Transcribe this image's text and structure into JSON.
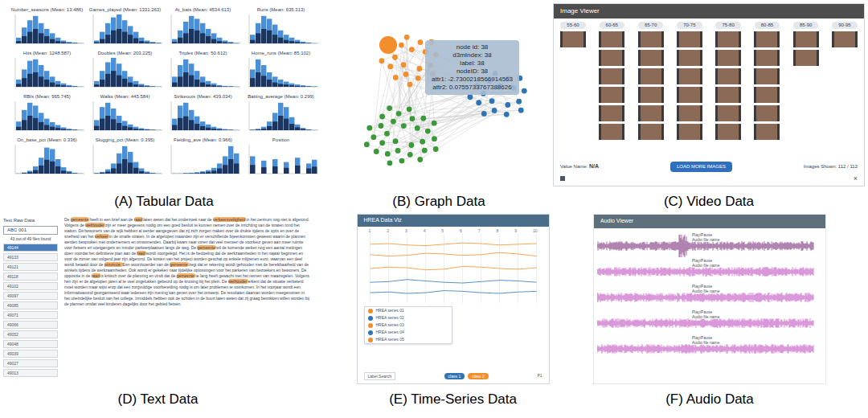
{
  "figure": {
    "panels": [
      {
        "id": "tabular",
        "caption": "(A) Tabular Data"
      },
      {
        "id": "graph",
        "caption": "(B) Graph Data"
      },
      {
        "id": "video",
        "caption": "(C) Video Data"
      },
      {
        "id": "text",
        "caption": "(D) Text Data"
      },
      {
        "id": "timeseries",
        "caption": "(E) Time-Series Data"
      },
      {
        "id": "audio",
        "caption": "(F) Audio Data"
      }
    ]
  },
  "tabular": {
    "charts": [
      {
        "title": "Number_seasons (Mean: 13.486)",
        "all": [
          20,
          55,
          80,
          95,
          70,
          50,
          35,
          20,
          10,
          5,
          3,
          1
        ],
        "selected": [
          8,
          25,
          40,
          50,
          35,
          25,
          15,
          8,
          4,
          2,
          1,
          0
        ]
      },
      {
        "title": "Games_played (Mean: 1331.263)",
        "all": [
          10,
          40,
          70,
          90,
          100,
          80,
          60,
          40,
          20,
          10,
          5,
          2
        ],
        "selected": [
          4,
          15,
          30,
          45,
          50,
          40,
          30,
          18,
          8,
          4,
          2,
          1
        ]
      },
      {
        "title": "At_bats (Mean: 4534.613)",
        "all": [
          15,
          45,
          75,
          95,
          85,
          70,
          50,
          35,
          20,
          10,
          5,
          2
        ],
        "selected": [
          5,
          20,
          35,
          50,
          45,
          35,
          25,
          15,
          8,
          4,
          2,
          0
        ]
      },
      {
        "title": "Runs (Mean: 635.313)",
        "all": [
          30,
          70,
          95,
          85,
          65,
          45,
          30,
          20,
          12,
          6,
          3,
          1
        ],
        "selected": [
          12,
          35,
          50,
          45,
          30,
          20,
          12,
          8,
          5,
          2,
          1,
          0
        ]
      },
      {
        "title": "Hits (Mean: 1248.587)",
        "all": [
          25,
          60,
          90,
          95,
          75,
          55,
          35,
          20,
          12,
          6,
          3,
          1
        ],
        "selected": [
          10,
          30,
          45,
          50,
          35,
          25,
          15,
          8,
          5,
          2,
          1,
          0
        ]
      },
      {
        "title": "Doubles (Mean: 203.225)",
        "all": [
          20,
          55,
          85,
          100,
          80,
          55,
          35,
          20,
          10,
          5,
          2,
          1
        ],
        "selected": [
          8,
          25,
          45,
          55,
          40,
          28,
          15,
          8,
          4,
          2,
          1,
          0
        ]
      },
      {
        "title": "Triples (Mean: 50.612)",
        "all": [
          35,
          75,
          95,
          80,
          55,
          35,
          20,
          12,
          6,
          3,
          2,
          1
        ],
        "selected": [
          15,
          35,
          50,
          40,
          25,
          15,
          8,
          5,
          2,
          1,
          1,
          0
        ]
      },
      {
        "title": "Home_runs (Mean: 85.102)",
        "all": [
          60,
          95,
          75,
          50,
          35,
          25,
          18,
          12,
          8,
          5,
          3,
          2
        ],
        "selected": [
          30,
          50,
          38,
          25,
          15,
          10,
          8,
          5,
          3,
          2,
          1,
          0
        ]
      },
      {
        "title": "RBIs (Mean: 565.745)",
        "all": [
          30,
          70,
          95,
          85,
          60,
          40,
          28,
          18,
          10,
          5,
          3,
          1
        ],
        "selected": [
          12,
          35,
          50,
          42,
          28,
          18,
          12,
          8,
          4,
          2,
          1,
          0
        ]
      },
      {
        "title": "Walks (Mean: 445.584)",
        "all": [
          35,
          80,
          95,
          75,
          50,
          32,
          20,
          12,
          7,
          4,
          2,
          1
        ],
        "selected": [
          15,
          40,
          50,
          38,
          25,
          15,
          10,
          5,
          3,
          2,
          1,
          0
        ]
      },
      {
        "title": "Strikeouts (Mean: 439.034)",
        "all": [
          40,
          85,
          95,
          70,
          48,
          30,
          20,
          12,
          7,
          4,
          2,
          1
        ],
        "selected": [
          18,
          42,
          48,
          35,
          22,
          14,
          9,
          5,
          3,
          1,
          1,
          0
        ]
      },
      {
        "title": "Batting_average (Mean: 0.299)",
        "all": [
          2,
          5,
          12,
          30,
          60,
          95,
          80,
          45,
          20,
          8,
          3,
          1
        ],
        "selected": [
          1,
          2,
          5,
          14,
          30,
          50,
          40,
          22,
          10,
          4,
          1,
          0
        ]
      },
      {
        "title": "On_base_pct (Mean: 0.336)",
        "all": [
          1,
          4,
          10,
          25,
          55,
          90,
          85,
          50,
          22,
          9,
          3,
          1
        ],
        "selected": [
          0,
          2,
          5,
          12,
          28,
          48,
          42,
          25,
          10,
          4,
          1,
          0
        ]
      },
      {
        "title": "Slugging_pct (Mean: 0.395)",
        "all": [
          2,
          6,
          15,
          35,
          70,
          95,
          75,
          40,
          18,
          7,
          3,
          1
        ],
        "selected": [
          1,
          3,
          7,
          18,
          35,
          50,
          38,
          20,
          8,
          3,
          1,
          0
        ]
      },
      {
        "title": "Fielding_ave (Mean: 0.966)",
        "all": [
          1,
          1,
          2,
          3,
          5,
          8,
          12,
          20,
          35,
          60,
          95,
          70
        ],
        "selected": [
          0,
          0,
          1,
          1,
          2,
          4,
          6,
          10,
          18,
          30,
          50,
          35
        ]
      },
      {
        "title": "Position",
        "all": [
          60,
          0,
          45,
          0,
          50,
          0,
          40,
          0,
          55,
          0,
          35,
          48
        ],
        "selected": [
          30,
          0,
          22,
          0,
          25,
          0,
          20,
          0,
          28,
          0,
          18,
          24
        ]
      }
    ]
  },
  "graph": {
    "nodes": [
      {
        "kind": "hub",
        "color": "#f28e2b"
      },
      {
        "kind": "node",
        "color": "#f28e2b"
      },
      {
        "kind": "node",
        "color": "#f28e2b"
      },
      {
        "kind": "node",
        "color": "#f28e2b"
      },
      {
        "kind": "node",
        "color": "#f28e2b"
      },
      {
        "kind": "node",
        "color": "#f28e2b"
      },
      {
        "kind": "node",
        "color": "#f28e2b"
      },
      {
        "kind": "node",
        "color": "#f28e2b"
      },
      {
        "kind": "node",
        "color": "#f28e2b"
      },
      {
        "kind": "node",
        "color": "#f28e2b"
      },
      {
        "kind": "node",
        "color": "#f28e2b"
      },
      {
        "kind": "node",
        "color": "#f28e2b"
      },
      {
        "kind": "node",
        "color": "#f28e2b"
      },
      {
        "kind": "node",
        "color": "#f28e2b"
      },
      {
        "kind": "node",
        "color": "#f28e2b"
      },
      {
        "kind": "node",
        "color": "#f28e2b"
      },
      {
        "kind": "node",
        "color": "#f28e2b"
      },
      {
        "kind": "node",
        "color": "#f28e2b"
      },
      {
        "kind": "node",
        "color": "#f28e2b"
      },
      {
        "kind": "node",
        "color": "#f28e2b"
      },
      {
        "kind": "node",
        "color": "#2e75b6"
      },
      {
        "kind": "node",
        "color": "#2e75b6"
      },
      {
        "kind": "node",
        "color": "#2e75b6"
      },
      {
        "kind": "node",
        "color": "#2e75b6"
      },
      {
        "kind": "node",
        "color": "#2e75b6"
      },
      {
        "kind": "node",
        "color": "#2e75b6"
      },
      {
        "kind": "node",
        "color": "#2e75b6"
      },
      {
        "kind": "node",
        "color": "#2e75b6"
      },
      {
        "kind": "node",
        "color": "#2e75b6"
      },
      {
        "kind": "node",
        "color": "#2e75b6"
      },
      {
        "kind": "node",
        "color": "#2e75b6"
      },
      {
        "kind": "node",
        "color": "#2e75b6"
      },
      {
        "kind": "node",
        "color": "#2e75b6"
      },
      {
        "kind": "node",
        "color": "#2e75b6"
      },
      {
        "kind": "node",
        "color": "#2e75b6"
      },
      {
        "kind": "node",
        "color": "#2e75b6"
      },
      {
        "kind": "node",
        "color": "#2e75b6"
      },
      {
        "kind": "node",
        "color": "#2e75b6"
      },
      {
        "kind": "node",
        "color": "#3a9a3a"
      },
      {
        "kind": "node",
        "color": "#3a9a3a"
      },
      {
        "kind": "node",
        "color": "#3a9a3a"
      },
      {
        "kind": "node",
        "color": "#3a9a3a"
      },
      {
        "kind": "node",
        "color": "#3a9a3a"
      },
      {
        "kind": "node",
        "color": "#3a9a3a"
      },
      {
        "kind": "node",
        "color": "#3a9a3a"
      },
      {
        "kind": "node",
        "color": "#3a9a3a"
      },
      {
        "kind": "node",
        "color": "#3a9a3a"
      },
      {
        "kind": "node",
        "color": "#3a9a3a"
      },
      {
        "kind": "node",
        "color": "#3a9a3a"
      },
      {
        "kind": "node",
        "color": "#3a9a3a"
      },
      {
        "kind": "node",
        "color": "#3a9a3a"
      },
      {
        "kind": "node",
        "color": "#3a9a3a"
      },
      {
        "kind": "node",
        "color": "#3a9a3a"
      },
      {
        "kind": "node",
        "color": "#3a9a3a"
      },
      {
        "kind": "node",
        "color": "#3a9a3a"
      },
      {
        "kind": "node",
        "color": "#3a9a3a"
      },
      {
        "kind": "node",
        "color": "#3a9a3a"
      },
      {
        "kind": "node",
        "color": "#3a9a3a"
      },
      {
        "kind": "node",
        "color": "#3a9a3a"
      },
      {
        "kind": "node",
        "color": "#3a9a3a"
      },
      {
        "kind": "node",
        "color": "#3a9a3a"
      },
      {
        "kind": "node",
        "color": "#3a9a3a"
      },
      {
        "kind": "node",
        "color": "#3a9a3a"
      },
      {
        "kind": "node",
        "color": "#3a9a3a"
      },
      {
        "kind": "node",
        "color": "#3a9a3a"
      },
      {
        "kind": "node",
        "color": "#3a9a3a"
      },
      {
        "kind": "node",
        "color": "#3a9a3a"
      },
      {
        "kind": "node",
        "color": "#3a9a3a"
      }
    ],
    "tooltip": [
      "node id: 38",
      "d3mIndex: 38",
      "label: 38",
      "nodeID: 38",
      "attr1: -2.7300218566914563",
      "attr2: 0.0755733767388626"
    ]
  },
  "video": {
    "title": "Image Viewer",
    "bins": [
      {
        "label": "55-60",
        "frames": 1
      },
      {
        "label": "60-65",
        "frames": 6
      },
      {
        "label": "65-70",
        "frames": 6
      },
      {
        "label": "70-75",
        "frames": 6
      },
      {
        "label": "75-80",
        "frames": 6
      },
      {
        "label": "80-85",
        "frames": 6
      },
      {
        "label": "85-90",
        "frames": 2
      },
      {
        "label": "90-95",
        "frames": 1
      }
    ],
    "value_label": "Value Name:",
    "value": "N/A",
    "load_button": "LOAD MORE IMAGES",
    "shown_label": "Images Shown:",
    "shown": "112 / 112",
    "close": "×"
  },
  "text": {
    "title": "Text Raw Data",
    "search": "ABC 001",
    "found": "43 out of 49 files found",
    "files": [
      {
        "name": "49144",
        "selected": true
      },
      {
        "name": "49133",
        "selected": false
      },
      {
        "name": "49121",
        "selected": false
      },
      {
        "name": "49118",
        "selected": false
      },
      {
        "name": "49102",
        "selected": false
      },
      {
        "name": "49097",
        "selected": false
      },
      {
        "name": "49085",
        "selected": false
      },
      {
        "name": "49071",
        "selected": false
      },
      {
        "name": "49066",
        "selected": false
      },
      {
        "name": "49052",
        "selected": false
      },
      {
        "name": "49048",
        "selected": false
      },
      {
        "name": "49039",
        "selected": false
      },
      {
        "name": "49027",
        "selected": false
      },
      {
        "name": "49013",
        "selected": false
      }
    ],
    "body": "De gemeente heeft in een brief aan de raad laten weten dat het onderzoek naar de verkeersveiligheid in het centrum nog niet is afgerond. Volgens de wethouder zijn er meer gegevens nodig om een goed besluit te kunnen nemen over de inrichting van de straten rond het station. De bewoners van de wijk hebben al eerder aangegeven dat zij zich zorgen maken over de drukte tijdens de spits en over de snelheid van het verkeer in de smalle straten. In de afgelopen maanden zijn er verschillende bijeenkomsten geweest waarin de plannen werden besproken met ondernemers en omwonenden. Daarbij kwam naar voren dat veel mensen de voorkeur geven aan meer ruimte voor fietsers en voetgangers en minder parkeerplaatsen langs de weg. De gemeente wil de komende weken nog een aantal metingen doen voordat het definitieve plan aan de raad wordt voorgelegd. Het is de bedoeling dat de werkzaamheden in het najaar beginnen en voor de zomer van volgend jaar zijn afgerond. De kosten van het project worden geschat op enkele miljoenen euro, waarvan een deel wordt betaald door de provincie. Een woordvoerder van de gemeente zegt dat er rekening wordt gehouden met de bereikbaarheid van de winkels tijdens de werkzaamheden. Ook wordt er gekeken naar tijdelijke oplossingen voor het parkeren van bezoekers en bewoners. De oppositie in de raad is kritisch over de planning en vindt dat de gemeente te lang heeft gewacht met het nemen van maatregelen. Volgens hen zijn er de afgelopen jaren al te veel ongelukken gebeurd op de kruising bij het plein. De wethouder erkent dat de situatie verbeterd moet worden maar wijst erop dat een zorgvuldige voorbereiding nodig is om later problemen te voorkomen. In het voorjaar wordt een informatieavond georganiseerd waar iedereen zijn mening kan geven over het ontwerp. De resultaten daarvan worden meegenomen in het uiteindelijke besluit van het college. Inmiddels hebben ook de scholen in de buurt laten weten dat zij graag betrokken willen worden bij de plannen omdat veel kinderen dagelijks door het gebied fietsen.",
    "highlights": [
      "gemeente",
      "wethouder",
      "raad",
      "verkeer",
      "provincie"
    ]
  },
  "timeseries": {
    "title": "HREA Data Viz",
    "ticks": [
      "1",
      "2",
      "3",
      "4",
      "5",
      "6",
      "7",
      "8",
      "9",
      "10"
    ],
    "series": [
      {
        "name": "HREA series 01",
        "color": "#f28e2b",
        "values": [
          5,
          5.2,
          5.1,
          4.8,
          4.9,
          5.3,
          5.2,
          5,
          4.9,
          5.1
        ]
      },
      {
        "name": "HREA series 02",
        "color": "#2e75b6",
        "values": [
          3,
          3.1,
          3.4,
          3.2,
          3,
          2.9,
          3.1,
          3.3,
          3.2,
          3
        ]
      },
      {
        "name": "HREA series 03",
        "color": "#f28e2b",
        "values": [
          7,
          6.8,
          6.9,
          7.2,
          7.1,
          6.9,
          7,
          7.3,
          7.1,
          6.8
        ]
      },
      {
        "name": "HREA series 04",
        "color": "#2e75b6",
        "values": [
          1.5,
          1.6,
          1.4,
          1.5,
          1.8,
          1.7,
          1.5,
          1.4,
          1.6,
          1.7
        ]
      },
      {
        "name": "HREA series 05",
        "color": "#f28e2b",
        "values": [
          8.5,
          8.6,
          8.4,
          8.3,
          8.5,
          8.7,
          8.6,
          8.4,
          8.5,
          8.6
        ]
      }
    ],
    "input": "Label Search",
    "classes": [
      {
        "name": "class 1",
        "color": "#2e75b6"
      },
      {
        "name": "class 2",
        "color": "#f28e2b"
      }
    ],
    "page": "P1"
  },
  "audio": {
    "title": "Audio Viewer",
    "tracks": [
      {
        "play": "Play/Pause",
        "name": "Audio file name",
        "color": "#7a2a7a"
      },
      {
        "play": "Play/Pause",
        "name": "Audio file name",
        "color": "#c04ac0"
      },
      {
        "play": "Play/Pause",
        "name": "Audio file name",
        "color": "#c04ac0"
      },
      {
        "play": "Play/Pause",
        "name": "Audio file name",
        "color": "#c04ac0"
      },
      {
        "play": "Play/Pause",
        "name": "Audio file name",
        "color": "#c04ac0"
      }
    ]
  }
}
